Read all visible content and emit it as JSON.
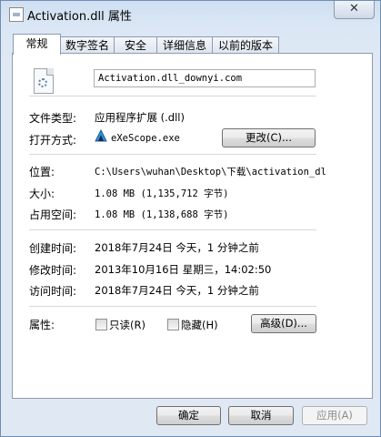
{
  "window": {
    "title": "Activation.dll 属性",
    "close_label": "✕"
  },
  "tabs": [
    {
      "label": "常规",
      "active": true
    },
    {
      "label": "数字签名",
      "active": false
    },
    {
      "label": "安全",
      "active": false
    },
    {
      "label": "详细信息",
      "active": false
    },
    {
      "label": "以前的版本",
      "active": false
    }
  ],
  "general": {
    "file_name": "Activation.dll_downyi.com",
    "file_type_label": "文件类型:",
    "file_type_value": "应用程序扩展 (.dll)",
    "open_with_label": "打开方式:",
    "open_with_value": "eXeScope.exe",
    "change_button": "更改(C)...",
    "location_label": "位置:",
    "location_value": "C:\\Users\\wuhan\\Desktop\\下载\\activation_dl",
    "size_label": "大小:",
    "size_value": "1.08 MB (1,135,712 字节)",
    "size_on_disk_label": "占用空间:",
    "size_on_disk_value": "1.08 MB (1,138,688 字节)",
    "created_label": "创建时间:",
    "created_value": "2018年7月24日 今天，1 分钟之前",
    "modified_label": "修改时间:",
    "modified_value": "2013年10月16日 星期三，14:02:50",
    "accessed_label": "访问时间:",
    "accessed_value": "2018年7月24日 今天，1 分钟之前",
    "attributes_label": "属性:",
    "readonly_label": "只读(R)",
    "hidden_label": "隐藏(H)",
    "advanced_button": "高级(D)..."
  },
  "footer": {
    "ok": "确定",
    "cancel": "取消",
    "apply": "应用(A)"
  }
}
